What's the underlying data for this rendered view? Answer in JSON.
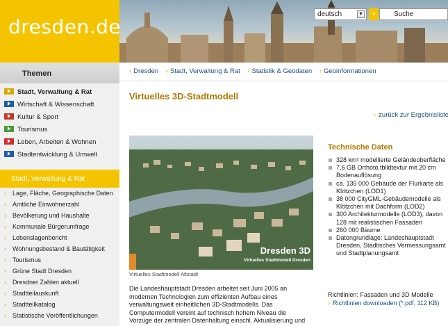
{
  "header": {
    "logo": "dresden.de",
    "language": "deutsch",
    "search_placeholder": "Suche"
  },
  "sidebar": {
    "heading": "Themen",
    "themes": [
      {
        "label": "Stadt, Verwaltung & Rat",
        "color": "#d9a800",
        "active": true
      },
      {
        "label": "Wirtschaft & Wissenschaft",
        "color": "#1f5fa8",
        "active": false
      },
      {
        "label": "Kultur & Sport",
        "color": "#c0392b",
        "active": false
      },
      {
        "label": "Tourismus",
        "color": "#4a9a3a",
        "active": false
      },
      {
        "label": "Leben, Arbeiten & Wohnen",
        "color": "#d62b2b",
        "active": false
      },
      {
        "label": "Stadtentwicklung & Umwelt",
        "color": "#1f5fa8",
        "active": false
      }
    ],
    "section_heading": "Stadt, Verwaltung & Rat",
    "sub_items": [
      "Lage, Fläche, Geographische Daten",
      "Amtliche Einwohnerzahl",
      "Bevölkerung und Haushalte",
      "Kommunale Bürgerumfrage",
      "Lebenslagenbericht",
      "Wohnungsbestand & Bautätigkeit",
      "Tourismus",
      "Grüne Stadt Dresden",
      "Dresdner Zahlen aktuell",
      "Stadtteilauskunft",
      "Stadtteilkatalog",
      "Statistische Veröffentlichungen"
    ]
  },
  "breadcrumb": [
    "Dresden",
    "Stadt, Verwaltung & Rat",
    "Statistik & Geodaten",
    "Geoinformationen"
  ],
  "main": {
    "title": "Virtuelles 3D-Stadtmodell",
    "back_link": "zurück zur Ergebnisliste",
    "image_title": "Dresden 3D",
    "image_subtitle": "Virtuelles Stadtmodell Dresden",
    "image_caption": "Virtuelles Stadtmodell Altstadt",
    "body_lines": [
      "Die Landeshauptstadt Dresden arbeitet seit Juni 2005 an",
      "modernen Technologien zum effizienten Aufbau eines",
      "verwaltungsweit einheitlichen 3D-Stadtmodells. Das",
      "Computermodell vereint auf technisch hohem Niveau die",
      "Vorzüge der zentralen Datenhaltung einschl. Aktualisierung und"
    ]
  },
  "tech": {
    "title": "Technische Daten",
    "items": [
      "328 km² modellierte Geländeoberfläche",
      "7,6 GB Orthoto.tbildtextur mit 20 cm Bodenauflösung",
      "ca. 135 000 Gebäude der Flurkarte als Klötzchen (LOD1)",
      "38 000 CityGML-Gebäudemodelle als Klötzchen mit Dachform (LOD2)",
      "300 Architekturmodelle (LOD3), davon 128 mit realistischen Fassaden",
      "260 000 Bäume",
      "Datengrundlage: Landeshauptstadt Dresden, Städtisches Vermessungsamt und Stadtplanungsamt"
    ],
    "guidelines_label": "Richtlinien: Fassaden und 3D Modelle",
    "guidelines_link": "Richtlinien downloaden (*.pdf, 112 KB)"
  }
}
